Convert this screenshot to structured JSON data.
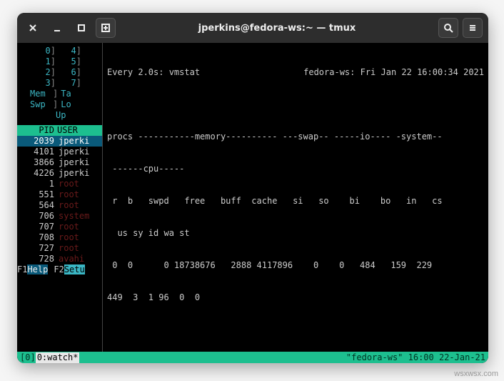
{
  "titlebar": {
    "title": "jperkins@fedora-ws:~ — tmux"
  },
  "tmux": {
    "session": "[0]",
    "window": "0:watch*",
    "status_right": "\"fedora-ws\" 16:00 22-Jan-21"
  },
  "htop": {
    "cpus": [
      {
        "n": "0",
        "v": ""
      },
      {
        "n": "4",
        "v": ""
      },
      {
        "n": "1",
        "v": ""
      },
      {
        "n": "5",
        "v": ""
      },
      {
        "n": "2",
        "v": ""
      },
      {
        "n": "6",
        "v": ""
      },
      {
        "n": "3",
        "v": ""
      },
      {
        "n": "7",
        "v": ""
      }
    ],
    "mem_label": "Mem",
    "mem_bar": "Ta",
    "swp_label": "Swp",
    "swp_bar": "Lo",
    "up_label": "Up",
    "header_pid": "PID",
    "header_user": "USER",
    "rows": [
      {
        "pid": "2039",
        "user": "jperki",
        "sel": true
      },
      {
        "pid": "4101",
        "user": "jperki"
      },
      {
        "pid": "3866",
        "user": "jperki"
      },
      {
        "pid": "4226",
        "user": "jperki"
      },
      {
        "pid": "1",
        "user": "root",
        "root": true
      },
      {
        "pid": "551",
        "user": "root",
        "root": true
      },
      {
        "pid": "564",
        "user": "root",
        "root": true
      },
      {
        "pid": "706",
        "user": "system",
        "root": true
      },
      {
        "pid": "707",
        "user": "root",
        "root": true
      },
      {
        "pid": "708",
        "user": "root",
        "root": true
      },
      {
        "pid": "727",
        "user": "root",
        "root": true
      },
      {
        "pid": "728",
        "user": "avahi",
        "root": true
      }
    ],
    "f1": "F1",
    "f1_lbl": "Help",
    "f2": "F2",
    "f2_lbl": "Setu"
  },
  "watch": {
    "header_left": "Every 2.0s: vmstat",
    "header_right": "fedora-ws: Fri Jan 22 16:00:34 2021",
    "line1": "procs -----------memory---------- ---swap-- -----io---- -system--",
    "line2": " ------cpu-----",
    "line3": " r  b   swpd   free   buff  cache   si   so    bi    bo   in   cs",
    "line4": "  us sy id wa st",
    "line5": " 0  0      0 18738676   2888 4117896    0    0   484   159  229 ",
    "line6": "449  3  1 96  0  0"
  },
  "watermark": "wsxwsx.com"
}
